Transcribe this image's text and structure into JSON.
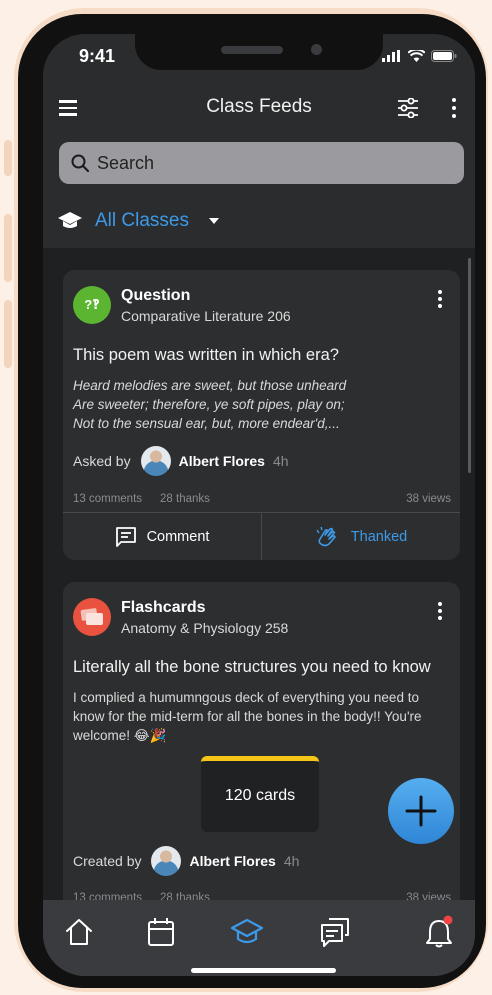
{
  "status": {
    "time": "9:41"
  },
  "appbar": {
    "title": "Class Feeds",
    "menu_icon": "hamburger-menu-icon",
    "filter_icon": "sliders-icon",
    "more_icon": "kebab-icon"
  },
  "search": {
    "placeholder": "Search"
  },
  "class_filter": {
    "label": "All Classes"
  },
  "colors": {
    "accent": "#3d9ae8",
    "question_badge": "#5cb531",
    "flashcards_badge": "#e8523f",
    "deck_stripe": "#f5c518",
    "fab": "#3f97e3"
  },
  "posts": [
    {
      "type": "Question",
      "icon": "question-bubble-icon",
      "badge_text": "?‽",
      "course": "Comparative Literature 206",
      "headline": "This poem was written in which era?",
      "body": [
        "Heard melodies are sweet, but those unheard",
        "Are sweeter; therefore, ye soft pipes, play on;",
        "Not to the sensual ear, but, more endear'd,..."
      ],
      "author_prefix": "Asked by",
      "author": "Albert Flores",
      "ago": "4h",
      "comments": "13 comments",
      "thanks": "28 thanks",
      "views": "38 views",
      "comment_label": "Comment",
      "thank_label": "Thanked"
    },
    {
      "type": "Flashcards",
      "icon": "flashcards-icon",
      "course": "Anatomy & Physiology 258",
      "headline": "Literally all the bone structures you need to know",
      "body": "I complied a humumngous deck of everything you need to know for the mid-term for all the bones in the body!! You're welcome! 😂🎉",
      "deck_label": "120 cards",
      "author_prefix": "Created by",
      "author": "Albert Flores",
      "ago": "4h",
      "comments": "13 comments",
      "thanks": "28 thanks",
      "views": "38 views"
    }
  ],
  "tabs": [
    {
      "name": "home",
      "icon": "home-icon",
      "active": false
    },
    {
      "name": "calendar",
      "icon": "calendar-icon",
      "active": false
    },
    {
      "name": "classes",
      "icon": "graduation-cap-icon",
      "active": true
    },
    {
      "name": "messages",
      "icon": "chat-icon",
      "active": false
    },
    {
      "name": "notifications",
      "icon": "bell-icon",
      "active": false,
      "badge": true
    }
  ]
}
